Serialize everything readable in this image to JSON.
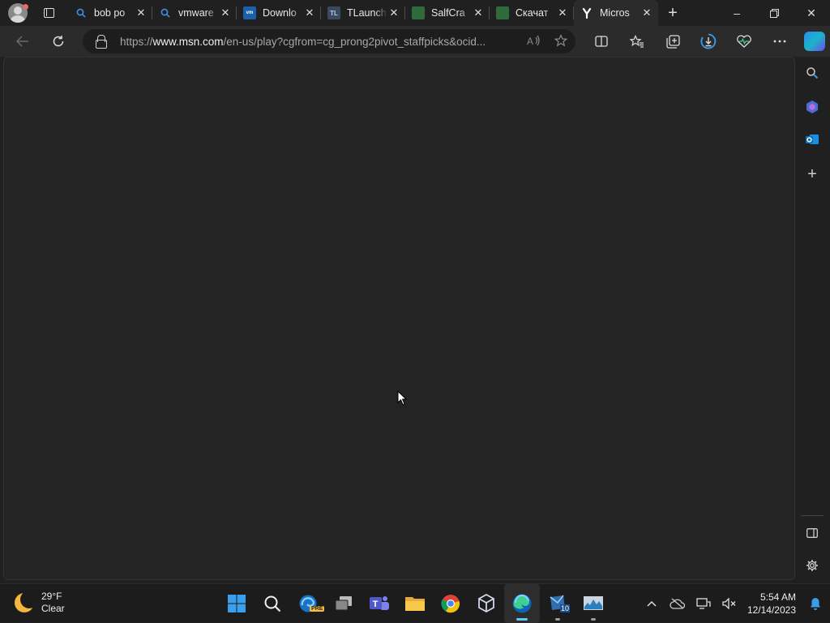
{
  "browser": {
    "tabs": [
      {
        "title": "bob po",
        "icon": "search-icon",
        "active": false
      },
      {
        "title": "vmware",
        "icon": "search-icon",
        "active": false
      },
      {
        "title": "Downlo",
        "icon": "vmware-icon",
        "active": false
      },
      {
        "title": "TLaunch",
        "icon": "tlauncher-icon",
        "active": false
      },
      {
        "title": "SalfCra",
        "icon": "minecraft-icon",
        "active": false
      },
      {
        "title": "Скачат",
        "icon": "minecraft-icon",
        "active": false
      },
      {
        "title": "Micros",
        "icon": "msn-play-icon",
        "active": true
      }
    ],
    "address": {
      "scheme": "https://",
      "host": "www.msn.com",
      "path": "/en-us/play?cgfrom=cg_prong2pivot_staffpicks&ocid..."
    }
  },
  "taskbar": {
    "weather": {
      "temp": "29°F",
      "condition": "Clear"
    },
    "clock": {
      "time": "5:54 AM",
      "date": "12/14/2023"
    },
    "edge_pre_badge": "PRE",
    "virtualbox_badge": "10"
  },
  "colors": {
    "accent": "#60c8f8",
    "page_bg": "#242424",
    "chrome_bg": "#202020",
    "toolbar_bg": "#2b2b2b"
  }
}
